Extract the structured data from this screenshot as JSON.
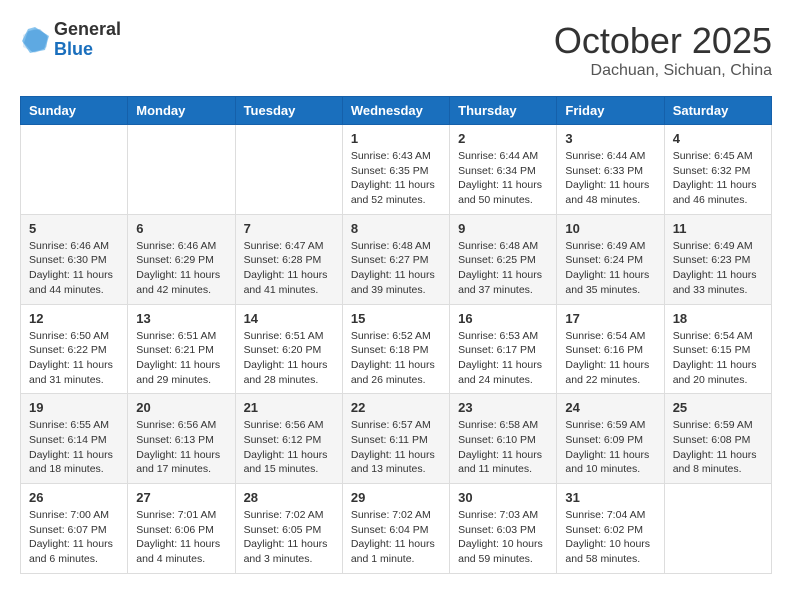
{
  "logo": {
    "general": "General",
    "blue": "Blue"
  },
  "title": "October 2025",
  "location": "Dachuan, Sichuan, China",
  "days_of_week": [
    "Sunday",
    "Monday",
    "Tuesday",
    "Wednesday",
    "Thursday",
    "Friday",
    "Saturday"
  ],
  "weeks": [
    [
      {
        "day": "",
        "info": ""
      },
      {
        "day": "",
        "info": ""
      },
      {
        "day": "",
        "info": ""
      },
      {
        "day": "1",
        "info": "Sunrise: 6:43 AM\nSunset: 6:35 PM\nDaylight: 11 hours\nand 52 minutes."
      },
      {
        "day": "2",
        "info": "Sunrise: 6:44 AM\nSunset: 6:34 PM\nDaylight: 11 hours\nand 50 minutes."
      },
      {
        "day": "3",
        "info": "Sunrise: 6:44 AM\nSunset: 6:33 PM\nDaylight: 11 hours\nand 48 minutes."
      },
      {
        "day": "4",
        "info": "Sunrise: 6:45 AM\nSunset: 6:32 PM\nDaylight: 11 hours\nand 46 minutes."
      }
    ],
    [
      {
        "day": "5",
        "info": "Sunrise: 6:46 AM\nSunset: 6:30 PM\nDaylight: 11 hours\nand 44 minutes."
      },
      {
        "day": "6",
        "info": "Sunrise: 6:46 AM\nSunset: 6:29 PM\nDaylight: 11 hours\nand 42 minutes."
      },
      {
        "day": "7",
        "info": "Sunrise: 6:47 AM\nSunset: 6:28 PM\nDaylight: 11 hours\nand 41 minutes."
      },
      {
        "day": "8",
        "info": "Sunrise: 6:48 AM\nSunset: 6:27 PM\nDaylight: 11 hours\nand 39 minutes."
      },
      {
        "day": "9",
        "info": "Sunrise: 6:48 AM\nSunset: 6:25 PM\nDaylight: 11 hours\nand 37 minutes."
      },
      {
        "day": "10",
        "info": "Sunrise: 6:49 AM\nSunset: 6:24 PM\nDaylight: 11 hours\nand 35 minutes."
      },
      {
        "day": "11",
        "info": "Sunrise: 6:49 AM\nSunset: 6:23 PM\nDaylight: 11 hours\nand 33 minutes."
      }
    ],
    [
      {
        "day": "12",
        "info": "Sunrise: 6:50 AM\nSunset: 6:22 PM\nDaylight: 11 hours\nand 31 minutes."
      },
      {
        "day": "13",
        "info": "Sunrise: 6:51 AM\nSunset: 6:21 PM\nDaylight: 11 hours\nand 29 minutes."
      },
      {
        "day": "14",
        "info": "Sunrise: 6:51 AM\nSunset: 6:20 PM\nDaylight: 11 hours\nand 28 minutes."
      },
      {
        "day": "15",
        "info": "Sunrise: 6:52 AM\nSunset: 6:18 PM\nDaylight: 11 hours\nand 26 minutes."
      },
      {
        "day": "16",
        "info": "Sunrise: 6:53 AM\nSunset: 6:17 PM\nDaylight: 11 hours\nand 24 minutes."
      },
      {
        "day": "17",
        "info": "Sunrise: 6:54 AM\nSunset: 6:16 PM\nDaylight: 11 hours\nand 22 minutes."
      },
      {
        "day": "18",
        "info": "Sunrise: 6:54 AM\nSunset: 6:15 PM\nDaylight: 11 hours\nand 20 minutes."
      }
    ],
    [
      {
        "day": "19",
        "info": "Sunrise: 6:55 AM\nSunset: 6:14 PM\nDaylight: 11 hours\nand 18 minutes."
      },
      {
        "day": "20",
        "info": "Sunrise: 6:56 AM\nSunset: 6:13 PM\nDaylight: 11 hours\nand 17 minutes."
      },
      {
        "day": "21",
        "info": "Sunrise: 6:56 AM\nSunset: 6:12 PM\nDaylight: 11 hours\nand 15 minutes."
      },
      {
        "day": "22",
        "info": "Sunrise: 6:57 AM\nSunset: 6:11 PM\nDaylight: 11 hours\nand 13 minutes."
      },
      {
        "day": "23",
        "info": "Sunrise: 6:58 AM\nSunset: 6:10 PM\nDaylight: 11 hours\nand 11 minutes."
      },
      {
        "day": "24",
        "info": "Sunrise: 6:59 AM\nSunset: 6:09 PM\nDaylight: 11 hours\nand 10 minutes."
      },
      {
        "day": "25",
        "info": "Sunrise: 6:59 AM\nSunset: 6:08 PM\nDaylight: 11 hours\nand 8 minutes."
      }
    ],
    [
      {
        "day": "26",
        "info": "Sunrise: 7:00 AM\nSunset: 6:07 PM\nDaylight: 11 hours\nand 6 minutes."
      },
      {
        "day": "27",
        "info": "Sunrise: 7:01 AM\nSunset: 6:06 PM\nDaylight: 11 hours\nand 4 minutes."
      },
      {
        "day": "28",
        "info": "Sunrise: 7:02 AM\nSunset: 6:05 PM\nDaylight: 11 hours\nand 3 minutes."
      },
      {
        "day": "29",
        "info": "Sunrise: 7:02 AM\nSunset: 6:04 PM\nDaylight: 11 hours\nand 1 minute."
      },
      {
        "day": "30",
        "info": "Sunrise: 7:03 AM\nSunset: 6:03 PM\nDaylight: 10 hours\nand 59 minutes."
      },
      {
        "day": "31",
        "info": "Sunrise: 7:04 AM\nSunset: 6:02 PM\nDaylight: 10 hours\nand 58 minutes."
      },
      {
        "day": "",
        "info": ""
      }
    ]
  ]
}
